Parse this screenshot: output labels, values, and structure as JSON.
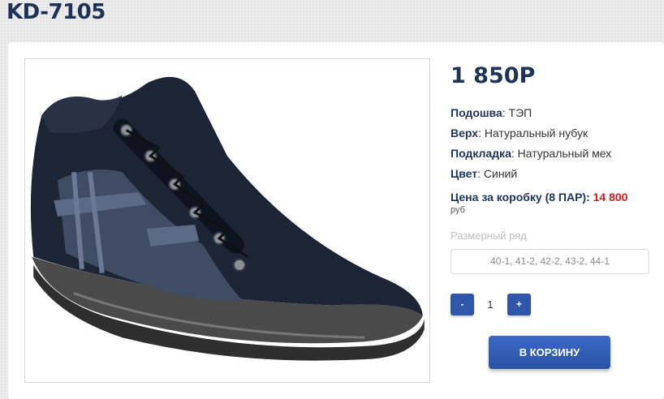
{
  "product": {
    "title": "KD-7105",
    "price": "1 850Р",
    "image_alt": "Ботинок"
  },
  "specs": [
    {
      "label": "Подошва",
      "value": "ТЭП"
    },
    {
      "label": "Верх",
      "value": "Натуральный нубук"
    },
    {
      "label": "Подкладка",
      "value": "Натуральный мех"
    },
    {
      "label": "Цвет",
      "value": "Синий"
    }
  ],
  "box_price": {
    "label": "Цена за коробку (8 ПАР):",
    "value": "14 800",
    "unit": "руб"
  },
  "sizes": {
    "label": "Размерный ряд",
    "value": "40-1, 41-2, 42-2, 43-2, 44-1"
  },
  "quantity": {
    "minus": "-",
    "value": "1",
    "plus": "+"
  },
  "cart_button": "В КОРЗИНУ",
  "colors": {
    "brand": "#1f3358",
    "button": "#2f56a8",
    "accent_red": "#d7191f"
  }
}
